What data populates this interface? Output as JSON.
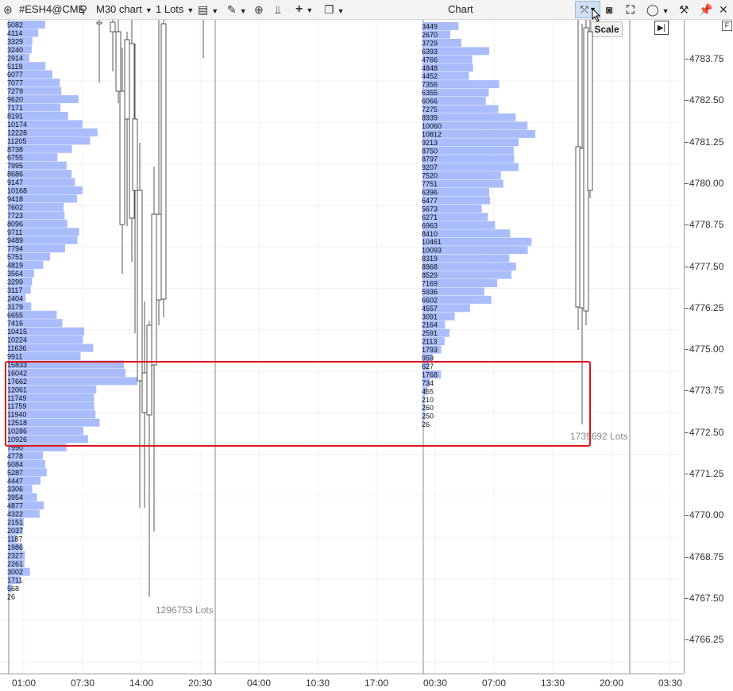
{
  "toolbar": {
    "symbol": "#ESH4@CME",
    "timeframe": "M30 chart",
    "lots": "1 Lots",
    "title": "Chart",
    "scale_tooltip": "Scale"
  },
  "icons": {
    "logo": "atas-logo-icon",
    "search": "search-icon",
    "template": "template-icon",
    "pen": "pen-icon",
    "zoom": "zoom-icon",
    "indicators": "indicators-icon",
    "crosshair": "crosshair-icon",
    "window": "window-icon",
    "scale": "scale-icon",
    "camera": "camera-icon",
    "fullscreen": "fullscreen-icon",
    "circle": "circle-icon",
    "settings": "settings-icon",
    "pin": "pin-icon",
    "close": "close-icon",
    "go_end": "go-to-end-icon"
  },
  "colors": {
    "profile": "#a9bcfb",
    "highlight": "#e0141e",
    "candle": "#555555"
  },
  "price_axis": {
    "labels": [
      "4783.75",
      "4782.50",
      "4781.25",
      "4780.00",
      "4778.75",
      "4777.50",
      "4776.25",
      "4775.00",
      "4773.75",
      "4772.50",
      "4771.25",
      "4770.00",
      "4768.75",
      "4767.50",
      "4766.25"
    ]
  },
  "time_axis": {
    "labels": [
      "01:00",
      "07:30",
      "14:00",
      "20:30",
      "04:00",
      "10:30",
      "17:00",
      "00:30",
      "07:00",
      "13:30",
      "20:00",
      "03:30"
    ]
  },
  "profiles": [
    {
      "total": "1296753 Lots",
      "volumes": [
        5082,
        4114,
        3329,
        3240,
        2914,
        5119,
        6077,
        7077,
        7279,
        9620,
        7171,
        8191,
        10174,
        12228,
        11205,
        8738,
        6755,
        7995,
        8686,
        9147,
        10168,
        9418,
        7602,
        7723,
        8096,
        9711,
        9489,
        7794,
        5751,
        4819,
        3564,
        3299,
        3117,
        2404,
        3179,
        6655,
        7416,
        10415,
        10224,
        11636,
        9911,
        15833,
        16042,
        17662,
        12061,
        11749,
        11759,
        11940,
        12518,
        10286,
        10926,
        7990,
        4778,
        5084,
        5287,
        4447,
        3306,
        3954,
        4877,
        4322,
        2151,
        2037,
        1187,
        1986,
        2327,
        2261,
        3002,
        1711,
        568,
        26
      ]
    },
    {
      "total": "1739692 Lots",
      "volumes": [
        3449,
        2670,
        3729,
        6393,
        4766,
        4848,
        4452,
        7356,
        6355,
        6066,
        7275,
        8939,
        10060,
        10812,
        9213,
        8750,
        8797,
        9207,
        7520,
        7751,
        6396,
        6477,
        5673,
        6271,
        6963,
        8410,
        10461,
        10093,
        8319,
        8968,
        8529,
        7169,
        5936,
        6602,
        4557,
        3091,
        2164,
        2591,
        2113,
        1793,
        959,
        627,
        1768,
        734,
        455,
        210,
        260,
        250,
        26
      ]
    }
  ]
}
